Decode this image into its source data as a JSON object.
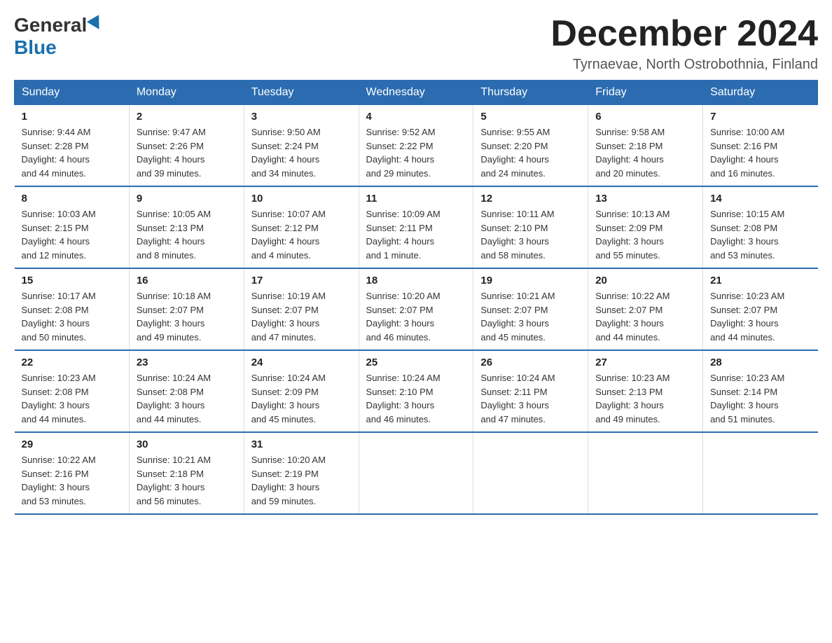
{
  "logo": {
    "general": "General",
    "blue": "Blue"
  },
  "title": "December 2024",
  "subtitle": "Tyrnaevae, North Ostrobothnia, Finland",
  "days_of_week": [
    "Sunday",
    "Monday",
    "Tuesday",
    "Wednesday",
    "Thursday",
    "Friday",
    "Saturday"
  ],
  "weeks": [
    [
      {
        "day": "1",
        "sunrise": "9:44 AM",
        "sunset": "2:28 PM",
        "daylight": "4 hours and 44 minutes."
      },
      {
        "day": "2",
        "sunrise": "9:47 AM",
        "sunset": "2:26 PM",
        "daylight": "4 hours and 39 minutes."
      },
      {
        "day": "3",
        "sunrise": "9:50 AM",
        "sunset": "2:24 PM",
        "daylight": "4 hours and 34 minutes."
      },
      {
        "day": "4",
        "sunrise": "9:52 AM",
        "sunset": "2:22 PM",
        "daylight": "4 hours and 29 minutes."
      },
      {
        "day": "5",
        "sunrise": "9:55 AM",
        "sunset": "2:20 PM",
        "daylight": "4 hours and 24 minutes."
      },
      {
        "day": "6",
        "sunrise": "9:58 AM",
        "sunset": "2:18 PM",
        "daylight": "4 hours and 20 minutes."
      },
      {
        "day": "7",
        "sunrise": "10:00 AM",
        "sunset": "2:16 PM",
        "daylight": "4 hours and 16 minutes."
      }
    ],
    [
      {
        "day": "8",
        "sunrise": "10:03 AM",
        "sunset": "2:15 PM",
        "daylight": "4 hours and 12 minutes."
      },
      {
        "day": "9",
        "sunrise": "10:05 AM",
        "sunset": "2:13 PM",
        "daylight": "4 hours and 8 minutes."
      },
      {
        "day": "10",
        "sunrise": "10:07 AM",
        "sunset": "2:12 PM",
        "daylight": "4 hours and 4 minutes."
      },
      {
        "day": "11",
        "sunrise": "10:09 AM",
        "sunset": "2:11 PM",
        "daylight": "4 hours and 1 minute."
      },
      {
        "day": "12",
        "sunrise": "10:11 AM",
        "sunset": "2:10 PM",
        "daylight": "3 hours and 58 minutes."
      },
      {
        "day": "13",
        "sunrise": "10:13 AM",
        "sunset": "2:09 PM",
        "daylight": "3 hours and 55 minutes."
      },
      {
        "day": "14",
        "sunrise": "10:15 AM",
        "sunset": "2:08 PM",
        "daylight": "3 hours and 53 minutes."
      }
    ],
    [
      {
        "day": "15",
        "sunrise": "10:17 AM",
        "sunset": "2:08 PM",
        "daylight": "3 hours and 50 minutes."
      },
      {
        "day": "16",
        "sunrise": "10:18 AM",
        "sunset": "2:07 PM",
        "daylight": "3 hours and 49 minutes."
      },
      {
        "day": "17",
        "sunrise": "10:19 AM",
        "sunset": "2:07 PM",
        "daylight": "3 hours and 47 minutes."
      },
      {
        "day": "18",
        "sunrise": "10:20 AM",
        "sunset": "2:07 PM",
        "daylight": "3 hours and 46 minutes."
      },
      {
        "day": "19",
        "sunrise": "10:21 AM",
        "sunset": "2:07 PM",
        "daylight": "3 hours and 45 minutes."
      },
      {
        "day": "20",
        "sunrise": "10:22 AM",
        "sunset": "2:07 PM",
        "daylight": "3 hours and 44 minutes."
      },
      {
        "day": "21",
        "sunrise": "10:23 AM",
        "sunset": "2:07 PM",
        "daylight": "3 hours and 44 minutes."
      }
    ],
    [
      {
        "day": "22",
        "sunrise": "10:23 AM",
        "sunset": "2:08 PM",
        "daylight": "3 hours and 44 minutes."
      },
      {
        "day": "23",
        "sunrise": "10:24 AM",
        "sunset": "2:08 PM",
        "daylight": "3 hours and 44 minutes."
      },
      {
        "day": "24",
        "sunrise": "10:24 AM",
        "sunset": "2:09 PM",
        "daylight": "3 hours and 45 minutes."
      },
      {
        "day": "25",
        "sunrise": "10:24 AM",
        "sunset": "2:10 PM",
        "daylight": "3 hours and 46 minutes."
      },
      {
        "day": "26",
        "sunrise": "10:24 AM",
        "sunset": "2:11 PM",
        "daylight": "3 hours and 47 minutes."
      },
      {
        "day": "27",
        "sunrise": "10:23 AM",
        "sunset": "2:13 PM",
        "daylight": "3 hours and 49 minutes."
      },
      {
        "day": "28",
        "sunrise": "10:23 AM",
        "sunset": "2:14 PM",
        "daylight": "3 hours and 51 minutes."
      }
    ],
    [
      {
        "day": "29",
        "sunrise": "10:22 AM",
        "sunset": "2:16 PM",
        "daylight": "3 hours and 53 minutes."
      },
      {
        "day": "30",
        "sunrise": "10:21 AM",
        "sunset": "2:18 PM",
        "daylight": "3 hours and 56 minutes."
      },
      {
        "day": "31",
        "sunrise": "10:20 AM",
        "sunset": "2:19 PM",
        "daylight": "3 hours and 59 minutes."
      },
      null,
      null,
      null,
      null
    ]
  ],
  "labels": {
    "sunrise": "Sunrise:",
    "sunset": "Sunset:",
    "daylight": "Daylight:"
  }
}
